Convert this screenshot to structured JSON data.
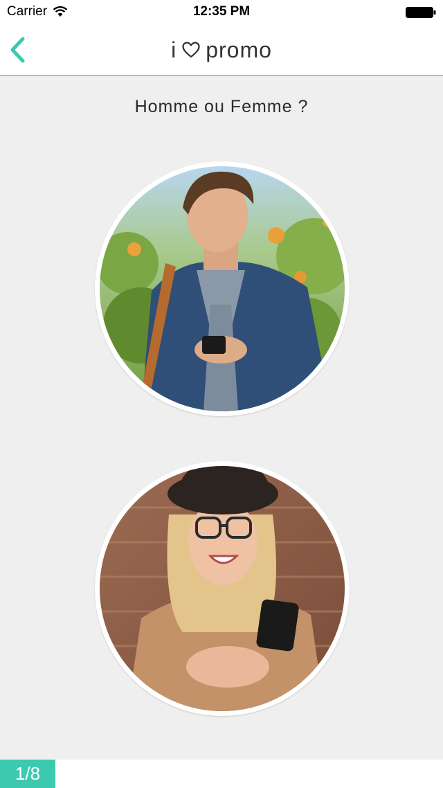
{
  "status_bar": {
    "carrier": "Carrier",
    "time": "12:35 PM",
    "wifi_icon": "wifi-icon",
    "battery_icon": "battery-full-icon"
  },
  "nav": {
    "back_icon": "chevron-left-icon",
    "title_prefix": "i",
    "title_icon": "heart-outline-icon",
    "title_suffix": "promo",
    "accent_color": "#3cc9ae"
  },
  "main": {
    "question": "Homme ou Femme ?"
  },
  "footer": {
    "progress": "1/8",
    "badge_color": "#3cc9ae"
  }
}
